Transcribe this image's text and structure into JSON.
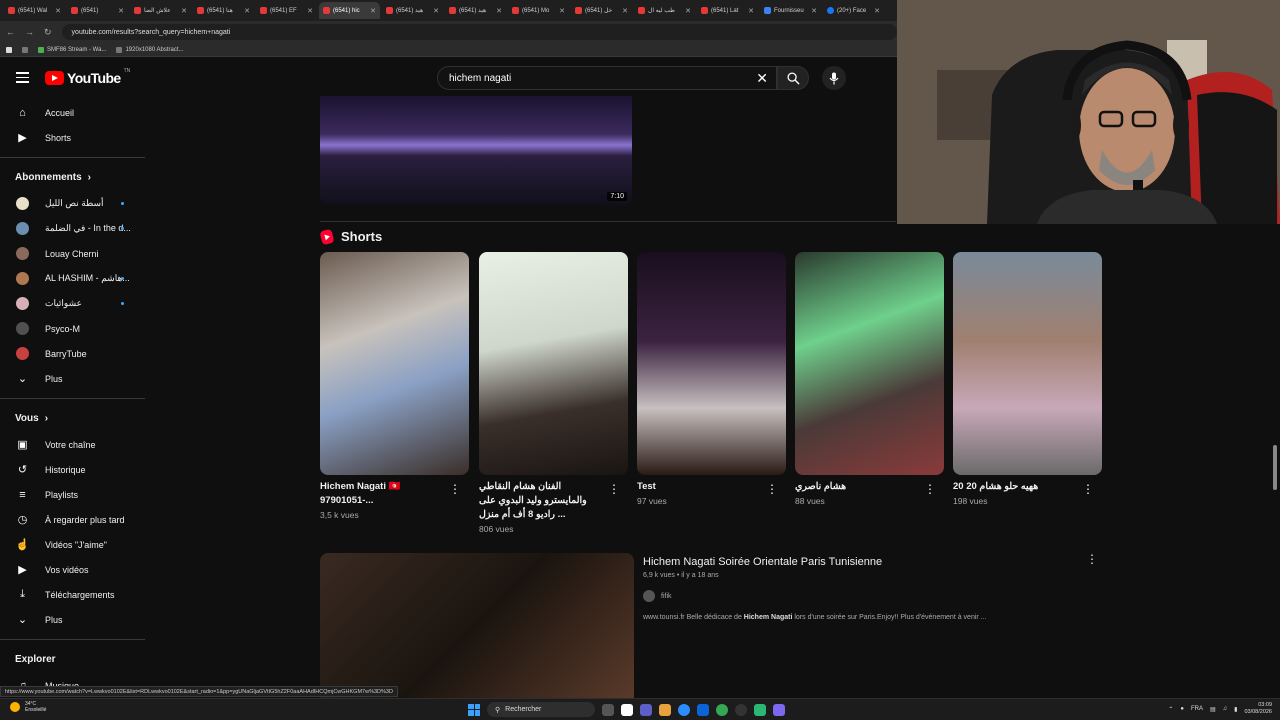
{
  "browser": {
    "tabs": [
      {
        "label": "(6541) Wal"
      },
      {
        "label": "(6541)"
      },
      {
        "label": "علاش الضا"
      },
      {
        "label": "(6541) هنا"
      },
      {
        "label": "(6541) EF"
      },
      {
        "label": "(6541) hic",
        "active": true
      },
      {
        "label": "(6541) هيد"
      },
      {
        "label": "(6541) هيد"
      },
      {
        "label": "(6541) Mo"
      },
      {
        "label": "(6541) خل"
      },
      {
        "label": "طب ليه ال"
      },
      {
        "label": "(6541) Lat"
      },
      {
        "label": "Fournisseu"
      },
      {
        "label": "(20+) Face"
      }
    ],
    "url": "youtube.com/results?search_query=hichem+nagati",
    "bookmarks": [
      "SMF86 Stream - Wa...",
      "1920x1080 Abstract..."
    ]
  },
  "header": {
    "logo_text": "YouTube",
    "logo_sup": "TN",
    "search_value": "hichem nagati"
  },
  "sidebar": {
    "main": [
      {
        "label": "Accueil",
        "icon": "home-icon"
      },
      {
        "label": "Shorts",
        "icon": "shorts-icon"
      }
    ],
    "subs_title": "Abonnements",
    "subs": [
      {
        "label": "أسطة نص الليل",
        "color": "#e8e0c8",
        "dot": true
      },
      {
        "label": "في الضلمة - In the d...",
        "color": "#6a8fb0",
        "dot": true
      },
      {
        "label": "Louay Cherni",
        "color": "#8a6a5a",
        "dot": false
      },
      {
        "label": "AL HASHIM - هاشم...",
        "color": "#b07850",
        "dot": true
      },
      {
        "label": "عشوائيات",
        "color": "#d8b0b8",
        "dot": true
      },
      {
        "label": "Psyco-M",
        "color": "#505050",
        "dot": false
      },
      {
        "label": "BarryTube",
        "color": "#c84040",
        "dot": false
      }
    ],
    "subs_more": "Plus",
    "you_title": "Vous",
    "you": [
      {
        "label": "Votre chaîne",
        "icon": "channel-icon"
      },
      {
        "label": "Historique",
        "icon": "history-icon"
      },
      {
        "label": "Playlists",
        "icon": "playlist-icon"
      },
      {
        "label": "À regarder plus tard",
        "icon": "clock-icon"
      },
      {
        "label": "Vidéos \"J'aime\"",
        "icon": "like-icon"
      },
      {
        "label": "Vos vidéos",
        "icon": "video-icon"
      },
      {
        "label": "Téléchargements",
        "icon": "download-icon"
      },
      {
        "label": "Plus",
        "icon": "chevron-down-icon"
      }
    ],
    "explore_title": "Explorer",
    "explore": [
      {
        "label": "Musique",
        "icon": "music-icon"
      }
    ]
  },
  "top_video": {
    "duration": "7:10"
  },
  "shorts": {
    "heading": "Shorts",
    "items": [
      {
        "title": "Hichem Nagati 🇹🇳 97901051-...",
        "views": "3,5 k vues"
      },
      {
        "title": "الفنان هشام النقاطي والمايسترو وليد البدوي على راديو 8 أف أم منزل ...",
        "views": "806 vues"
      },
      {
        "title": "Test",
        "views": "97 vues"
      },
      {
        "title": "هشام ناصري",
        "views": "88 vues"
      },
      {
        "title": "ههيه حلو هشام 20 20",
        "views": "198 vues"
      }
    ]
  },
  "video": {
    "title": "Hichem Nagati Soirée Orientale Paris Tunisienne",
    "meta": "6,9 k vues • il y a 18 ans",
    "channel": "fifik",
    "desc_pre": "www.tounsi.fr Belle dédicace de ",
    "desc_bold": "Hichem Nagati",
    "desc_post": " lors d'une soirée sur Paris.Enjoy!! Plus d'événement à venir ..."
  },
  "status_url": "https://www.youtube.com/watch?v=Lwwkvo0102E&list=RDLwwkvo0102E&start_radio=1&pp=ygUNaGljaGVtIG5hZ2F0aaAHAdIHCQmjCwGHKGM7w%3D%3D",
  "taskbar": {
    "temp": "34°C",
    "weather": "Ensoleillé",
    "search": "Rechercher",
    "lang": "FRA",
    "time": "03:09",
    "date": "03/08/2026"
  }
}
